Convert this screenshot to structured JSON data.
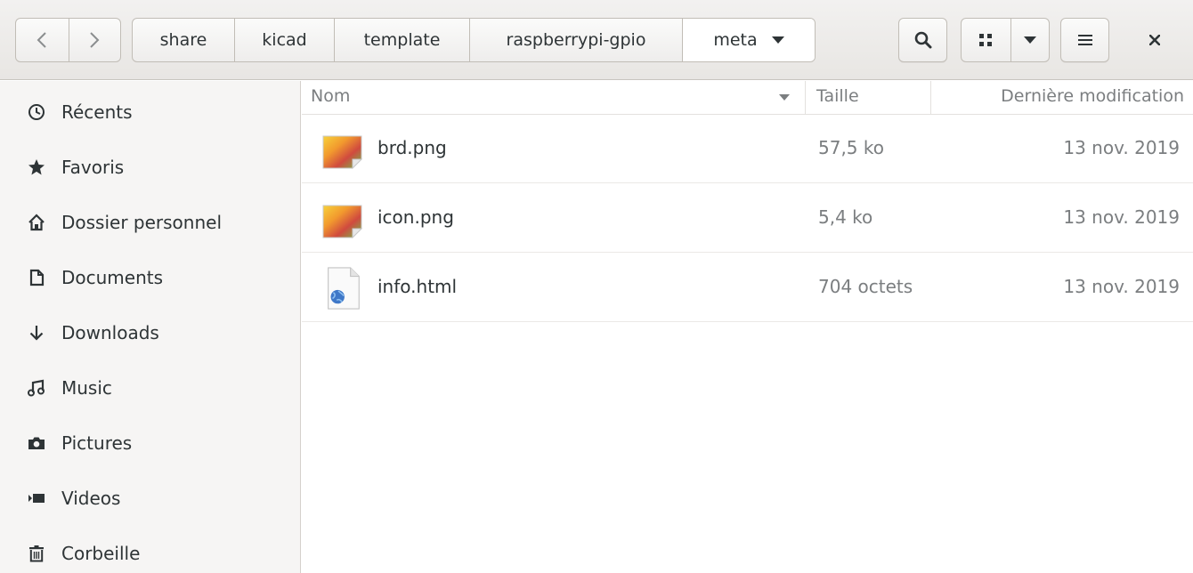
{
  "header": {
    "breadcrumbs": [
      "share",
      "kicad",
      "template",
      "raspberrypi-gpio",
      "meta"
    ]
  },
  "sidebar": {
    "items": [
      {
        "label": "Récents",
        "icon": "clock-icon"
      },
      {
        "label": "Favoris",
        "icon": "star-icon"
      },
      {
        "label": "Dossier personnel",
        "icon": "home-icon"
      },
      {
        "label": "Documents",
        "icon": "document-icon"
      },
      {
        "label": "Downloads",
        "icon": "download-icon"
      },
      {
        "label": "Music",
        "icon": "music-icon"
      },
      {
        "label": "Pictures",
        "icon": "camera-icon"
      },
      {
        "label": "Videos",
        "icon": "video-icon"
      },
      {
        "label": "Corbeille",
        "icon": "trash-icon"
      }
    ]
  },
  "columns": {
    "name": "Nom",
    "size": "Taille",
    "modified": "Dernière modification"
  },
  "files": [
    {
      "name": "brd.png",
      "size": "57,5 ko",
      "modified": "13 nov. 2019",
      "icon": "image-file-icon"
    },
    {
      "name": "icon.png",
      "size": "5,4 ko",
      "modified": "13 nov. 2019",
      "icon": "image-file-icon"
    },
    {
      "name": "info.html",
      "size": "704 octets",
      "modified": "13 nov. 2019",
      "icon": "html-file-icon"
    }
  ],
  "colors": {
    "sidebar_bg": "#f6f5f4",
    "header_bg": "#e8e6e3",
    "text": "#2e3436",
    "muted_text": "#7b7e80"
  }
}
